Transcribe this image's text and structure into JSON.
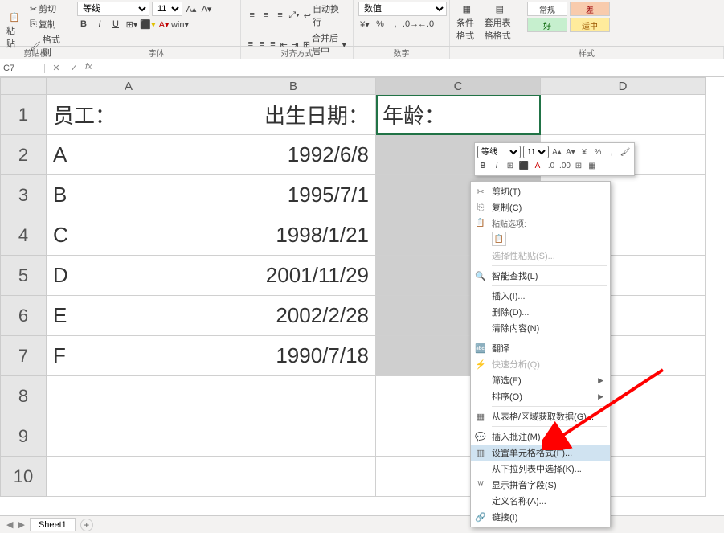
{
  "ribbon": {
    "clipboard": {
      "paste": "粘贴",
      "cut": "剪切",
      "copy": "复制",
      "formatPainter": "格式刷",
      "label": "剪贴板"
    },
    "font": {
      "name": "等线",
      "size": "11",
      "bold": "B",
      "italic": "I",
      "underline": "U",
      "label": "字体"
    },
    "align": {
      "wrap": "自动换行",
      "merge": "合并后居中",
      "label": "对齐方式"
    },
    "number": {
      "format": "数值",
      "label": "数字"
    },
    "styles": {
      "cond": "条件格式",
      "table": "套用表格格式",
      "normal": "常规",
      "bad": "差",
      "good": "好",
      "neutral": "适中",
      "label": "样式"
    }
  },
  "namebox": "C7",
  "fx": "fx",
  "columns": [
    "A",
    "B",
    "C",
    "D"
  ],
  "rows": [
    "1",
    "2",
    "3",
    "4",
    "5",
    "6",
    "7",
    "8",
    "9",
    "10"
  ],
  "data": {
    "A1": "员工：",
    "B1": "出生日期：",
    "C1": "年龄：",
    "A2": "A",
    "B2": "1992/6/8",
    "A3": "B",
    "B3": "1995/7/1",
    "A4": "C",
    "B4": "1998/1/21",
    "A5": "D",
    "B5": "2001/11/29",
    "A6": "E",
    "B6": "2002/2/28",
    "A7": "F",
    "B7": "1990/7/18"
  },
  "miniTB": {
    "font": "等线",
    "size": "11"
  },
  "ctx": {
    "cut": "剪切(T)",
    "copy": "复制(C)",
    "pasteOpt": "粘贴选项:",
    "pasteSpecial": "选择性粘贴(S)...",
    "smartLookup": "智能查找(L)",
    "insert": "插入(I)...",
    "delete": "删除(D)...",
    "clear": "清除内容(N)",
    "translate": "翻译",
    "quick": "快速分析(Q)",
    "filter": "筛选(E)",
    "sort": "排序(O)",
    "fromTable": "从表格/区域获取数据(G)...",
    "comment": "插入批注(M)",
    "formatCells": "设置单元格格式(F)...",
    "pickList": "从下拉列表中选择(K)...",
    "phonetic": "显示拼音字段(S)",
    "defineName": "定义名称(A)...",
    "link": "链接(I)"
  },
  "sheet": {
    "name": "Sheet1"
  }
}
